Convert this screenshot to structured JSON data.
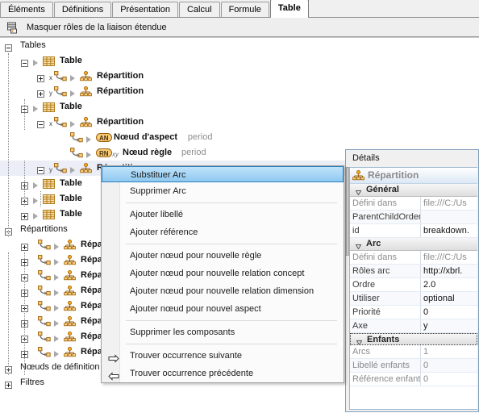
{
  "tabs": [
    {
      "label": "Éléments",
      "active": false
    },
    {
      "label": "Définitions",
      "active": false
    },
    {
      "label": "Présentation",
      "active": false
    },
    {
      "label": "Calcul",
      "active": false
    },
    {
      "label": "Formule",
      "active": false
    },
    {
      "label": "Table",
      "active": true
    }
  ],
  "toolbar": {
    "icon": "hide-roles-icon",
    "label": "Masquer rôles de la liaison étendue"
  },
  "tree": {
    "nodes": [
      {
        "label": "Tables",
        "kind": "group",
        "indent": 0,
        "expander": "minus"
      },
      {
        "label": "Table",
        "kind": "table",
        "indent": 1,
        "expander": "minus"
      },
      {
        "label": "Répartition",
        "kind": "breakdown",
        "indent": 2,
        "expander": "plus",
        "axis": "x"
      },
      {
        "label": "Répartition",
        "kind": "breakdown",
        "indent": 2,
        "expander": "plus",
        "axis": "y"
      },
      {
        "label": "Table",
        "kind": "table",
        "indent": 1,
        "expander": "minus"
      },
      {
        "label": "Répartition",
        "kind": "breakdown",
        "indent": 2,
        "expander": "minus",
        "axis": "x"
      },
      {
        "label": "Nœud d'aspect",
        "sub": "period",
        "kind": "aspect",
        "indent": 3,
        "badge": "AN"
      },
      {
        "label": "Nœud règle",
        "sub": "period",
        "kind": "rule",
        "indent": 3,
        "badge": "RN",
        "mark": "xy"
      },
      {
        "label": "Répartition",
        "kind": "breakdown",
        "indent": 2,
        "expander": "minus",
        "axis": "y",
        "selected": true
      },
      {
        "label": "Table",
        "kind": "table",
        "indent": 1,
        "expander": "plus"
      },
      {
        "label": "Table",
        "kind": "table",
        "indent": 1,
        "expander": "plus"
      },
      {
        "label": "Table",
        "kind": "table",
        "indent": 1,
        "expander": "plus"
      },
      {
        "label": "Répartitions",
        "kind": "group",
        "indent": 0,
        "expander": "minus"
      },
      {
        "label": "Répa",
        "kind": "breakdown",
        "indent": 1,
        "expander": "plus"
      },
      {
        "label": "Répa",
        "kind": "breakdown",
        "indent": 1,
        "expander": "plus"
      },
      {
        "label": "Répa",
        "kind": "breakdown",
        "indent": 1,
        "expander": "plus"
      },
      {
        "label": "Répa",
        "kind": "breakdown",
        "indent": 1,
        "expander": "plus"
      },
      {
        "label": "Répa",
        "kind": "breakdown",
        "indent": 1,
        "expander": "plus"
      },
      {
        "label": "Répa",
        "kind": "breakdown",
        "indent": 1,
        "expander": "plus"
      },
      {
        "label": "Répa",
        "kind": "breakdown",
        "indent": 1,
        "expander": "plus"
      },
      {
        "label": "Répa",
        "kind": "breakdown",
        "indent": 1,
        "expander": "plus"
      },
      {
        "label": "Nœuds de définition",
        "kind": "group",
        "indent": 0,
        "expander": "plus"
      },
      {
        "label": "Filtres",
        "kind": "group",
        "indent": 0,
        "expander": "plus"
      }
    ]
  },
  "context_menu": {
    "items": [
      {
        "label": "Substituer Arc",
        "highlighted": true
      },
      {
        "label": "Supprimer Arc"
      },
      {
        "separator": true
      },
      {
        "label": "Ajouter libellé"
      },
      {
        "label": "Ajouter référence"
      },
      {
        "separator": true
      },
      {
        "label": "Ajouter nœud pour nouvelle règle"
      },
      {
        "label": "Ajouter nœud pour nouvelle relation concept"
      },
      {
        "label": "Ajouter nœud pour nouvelle relation dimension"
      },
      {
        "label": "Ajouter nœud pour nouvel aspect"
      },
      {
        "separator": true
      },
      {
        "label": "Supprimer les composants"
      },
      {
        "separator": true
      },
      {
        "label": "Trouver occurrence suivante",
        "icon": "arrow-right-icon"
      },
      {
        "label": "Trouver occurrence précédente",
        "icon": "arrow-left-icon"
      }
    ]
  },
  "details": {
    "title": "Détails",
    "object_title": "Répartition",
    "object_icon": "breakdown-icon",
    "groups": [
      {
        "name": "Général",
        "rows": [
          {
            "key": "Défini dans",
            "value": "file:///C:/Us",
            "muted": true
          },
          {
            "key": "ParentChildOrder",
            "value": "",
            "muted": false
          },
          {
            "key": "id",
            "value": "breakdown.",
            "muted": false
          }
        ]
      },
      {
        "name": "Arc",
        "rows": [
          {
            "key": "Défini dans",
            "value": "file:///C:/Us",
            "muted": true
          },
          {
            "key": "Rôles arc",
            "value": "http://xbrl.",
            "muted": false
          },
          {
            "key": "Ordre",
            "value": "2.0",
            "muted": false
          },
          {
            "key": "Utiliser",
            "value": "optional",
            "muted": false
          },
          {
            "key": "Priorité",
            "value": "0",
            "muted": false
          },
          {
            "key": "Axe",
            "value": "y",
            "muted": false
          }
        ]
      },
      {
        "name": "Enfants",
        "dotted": true,
        "rows": [
          {
            "key": "Arcs",
            "value": "1",
            "muted": true
          },
          {
            "key": "Libellé enfants",
            "value": "0",
            "muted": true
          },
          {
            "key": "Référence enfants",
            "value": "0",
            "muted": true
          }
        ]
      }
    ]
  },
  "colors": {
    "accent": "#9cd2f5",
    "icon_orange": "#f5a623",
    "icon_outline": "#9a5f06",
    "selection_tree": "#eceef7"
  }
}
